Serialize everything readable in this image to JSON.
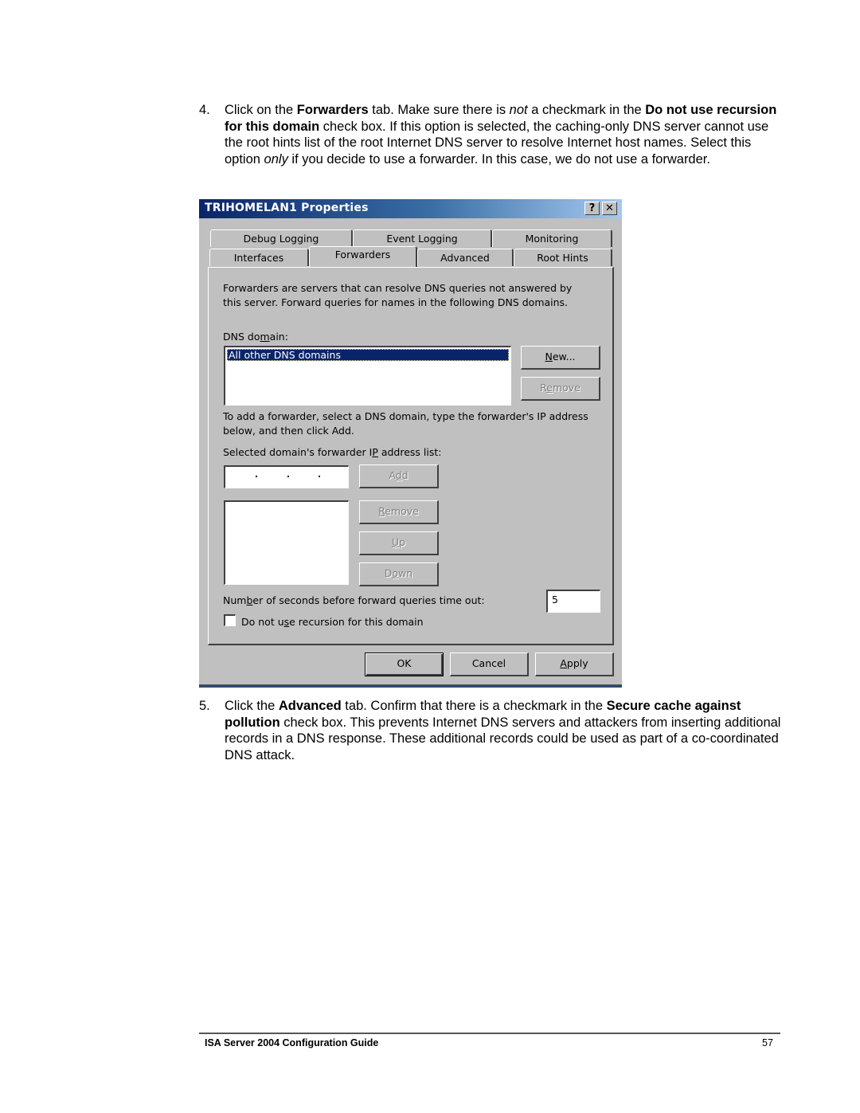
{
  "steps": [
    {
      "number": "4.",
      "segments": [
        {
          "text": "Click on the ",
          "style": "normal"
        },
        {
          "text": "Forwarders",
          "style": "bold"
        },
        {
          "text": " tab. Make sure there is ",
          "style": "normal"
        },
        {
          "text": "not",
          "style": "italic"
        },
        {
          "text": " a checkmark in the ",
          "style": "normal"
        },
        {
          "text": "Do not use recursion for this domain",
          "style": "bold"
        },
        {
          "text": " check box. If this option is selected, the caching-only DNS server cannot  use the root hints list of the root Internet DNS server to resolve Internet host names. Select this option ",
          "style": "normal"
        },
        {
          "text": "only",
          "style": "italic"
        },
        {
          "text": " if you decide to use a forwarder. In this case, we do not use a forwarder.",
          "style": "normal"
        }
      ]
    },
    {
      "number": "5.",
      "segments": [
        {
          "text": "Click the ",
          "style": "normal"
        },
        {
          "text": "Advanced",
          "style": "bold"
        },
        {
          "text": " tab. Confirm that there is a checkmark in the ",
          "style": "normal"
        },
        {
          "text": "Secure cache against pollution",
          "style": "bold"
        },
        {
          "text": " check box. This prevents Internet DNS servers and attackers from inserting additional records in a DNS response. These additional records could be used as part of a co-coordinated DNS attack.",
          "style": "normal"
        }
      ]
    }
  ],
  "dialog": {
    "title": "TRIHOMELAN1 Properties",
    "help_icon": "?",
    "close_icon": "✕",
    "tabs_row1": [
      {
        "label": "Debug Logging"
      },
      {
        "label": "Event Logging"
      },
      {
        "label": "Monitoring"
      }
    ],
    "tabs_row2": [
      {
        "label": "Interfaces"
      },
      {
        "label": "Forwarders",
        "active": true
      },
      {
        "label": "Advanced"
      },
      {
        "label": "Root Hints"
      }
    ],
    "intro_line1": "Forwarders are servers that can resolve DNS queries not answered by",
    "intro_line2": "this server. Forward queries for names in the following DNS domains.",
    "dns_domain_label": "DNS domain:",
    "dns_domains": [
      "All other DNS domains"
    ],
    "selected_domain": "All other DNS domains",
    "new_button": "New...",
    "remove_domain_button": "Remove",
    "add_hint_line1": "To add a forwarder, select a DNS domain, type the forwarder's IP address",
    "add_hint_line2": "below, and then click Add.",
    "ip_list_label": "Selected domain's forwarder IP address list:",
    "ip_input_value": "",
    "add_button": "Add",
    "remove_ip_button": "Remove",
    "up_button": "Up",
    "down_button": "Down",
    "timeout_label": "Number of seconds before forward queries time out:",
    "timeout_value": "5",
    "recursion_checkbox_label": "Do not use recursion for this domain",
    "recursion_checked": false,
    "ok_button": "OK",
    "cancel_button": "Cancel",
    "apply_button": "Apply"
  },
  "footer": {
    "title": "ISA Server 2004 Configuration Guide",
    "page": "57"
  }
}
